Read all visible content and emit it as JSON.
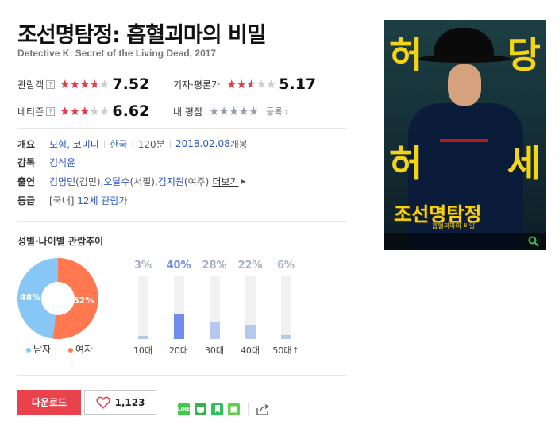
{
  "movie": {
    "title": "조선명탐정: 흡혈괴마의 비밀",
    "subtitle": "Detective K: Secret of the Living Dead, 2017"
  },
  "ratings": {
    "audience": {
      "label": "관람객",
      "help": "?",
      "score": "7.52",
      "value": 7.52
    },
    "critics": {
      "label": "기자·평론가",
      "score": "5.17",
      "value": 5.17
    },
    "netizen": {
      "label": "네티즌",
      "help": "?",
      "score": "6.62",
      "value": 6.62
    },
    "mine": {
      "label": "내 평점",
      "enroll": "등록 ›"
    }
  },
  "info": {
    "overview_label": "개요",
    "genres": "모험, 코미디",
    "country": "한국",
    "runtime": "120분",
    "release_date": "2018.02.08",
    "release_suffix": " 개봉",
    "director_label": "감독",
    "director": "김석윤",
    "cast_label": "출연",
    "cast_1": "김명민",
    "cast_1_role": "(김민), ",
    "cast_2": "오달수",
    "cast_2_role": "(서필), ",
    "cast_3": "김지원",
    "cast_3_role": "(여주) ",
    "cast_more": "더보기",
    "grade_label": "등급",
    "grade_prefix": "[국내]",
    "grade": "12세 관람가"
  },
  "trend": {
    "title": "성별·나이별 관람추이",
    "gender": {
      "male_pct": "48%",
      "female_pct": "52%",
      "male_label": "남자",
      "female_label": "여자",
      "male_value": 48,
      "female_value": 52
    },
    "ages": [
      {
        "label": "10대",
        "pct": "3%",
        "value": 3
      },
      {
        "label": "20대",
        "pct": "40%",
        "value": 40
      },
      {
        "label": "30대",
        "pct": "28%",
        "value": 28
      },
      {
        "label": "40대",
        "pct": "22%",
        "value": 22
      },
      {
        "label": "50대↑",
        "pct": "6%",
        "value": 6
      }
    ]
  },
  "poster": {
    "char_1": "허",
    "char_2": "당",
    "char_3": "허",
    "char_4": "세",
    "logo": "조선명탐정",
    "sub": "흡혈괴마의 비밀"
  },
  "actions": {
    "download": "다운로드",
    "like_count": "1,123"
  },
  "colors": {
    "accent_red": "#e8434d",
    "star_red": "#e83a4a",
    "link_blue": "#2a55c0",
    "male_blue": "#86c7f6",
    "female_orange": "#ff7850",
    "age_highlight": "#6e8de9"
  }
}
